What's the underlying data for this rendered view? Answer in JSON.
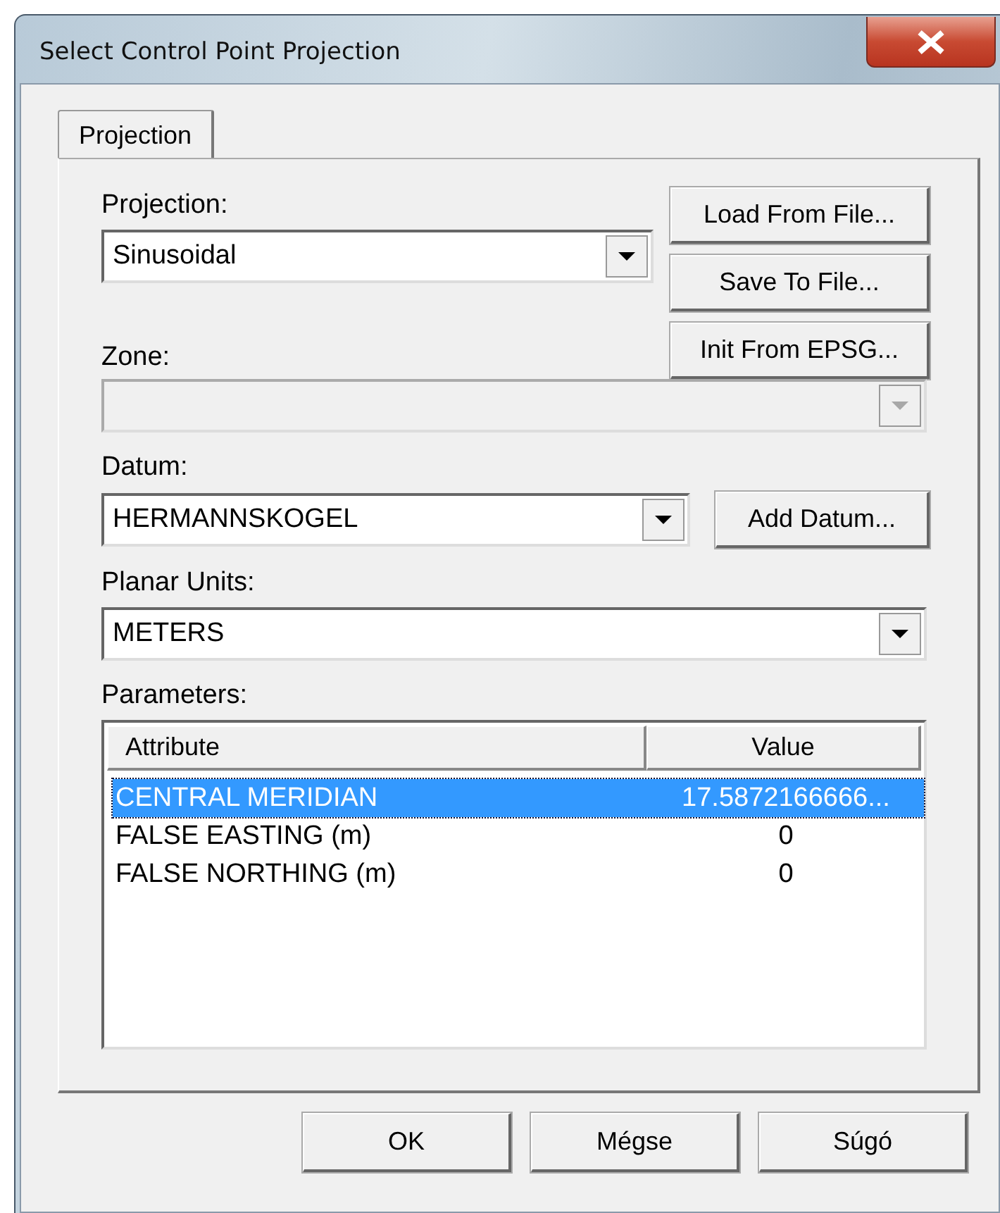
{
  "window": {
    "title": "Select Control Point Projection"
  },
  "tabs": [
    {
      "label": "Projection",
      "selected": true
    }
  ],
  "projection": {
    "label": "Projection:",
    "value": "Sinusoidal",
    "disabled": false
  },
  "file_buttons": [
    "Load From File...",
    "Save To File...",
    "Init From EPSG..."
  ],
  "zone": {
    "label": "Zone:",
    "disabled": true
  },
  "datum": {
    "label": "Datum:",
    "value": "HERMANNSKOGEL",
    "disabled": false
  },
  "add_datum_button": "Add Datum...",
  "planar_units": {
    "label": "Planar Units:",
    "value": "METERS",
    "disabled": false
  },
  "parameters": {
    "label": "Parameters:",
    "columns": [
      "Attribute",
      "Value"
    ],
    "rows": [
      {
        "attribute": "CENTRAL MERIDIAN",
        "value": "17.5872166666...",
        "selected": true
      },
      {
        "attribute": "FALSE EASTING (m)",
        "value": "0",
        "selected": false
      },
      {
        "attribute": "FALSE NORTHING (m)",
        "value": "0",
        "selected": false
      }
    ]
  },
  "buttons": [
    "OK",
    "Mégse",
    "Súgó"
  ]
}
